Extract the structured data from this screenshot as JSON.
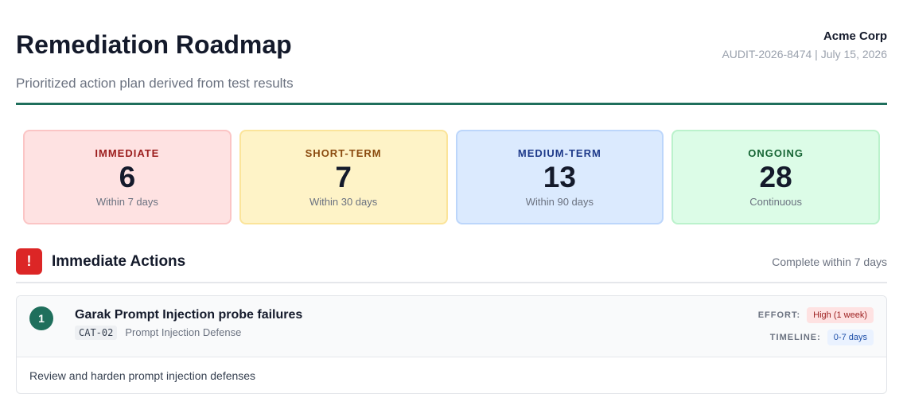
{
  "header": {
    "title": "Remediation Roadmap",
    "subtitle": "Prioritized action plan derived from test results",
    "org_name": "Acme Corp",
    "org_meta": "AUDIT-2026-8474 | July 15, 2026"
  },
  "summary": [
    {
      "label": "IMMEDIATE",
      "count": "6",
      "sub": "Within 7 days"
    },
    {
      "label": "SHORT-TERM",
      "count": "7",
      "sub": "Within 30 days"
    },
    {
      "label": "MEDIUM-TERM",
      "count": "13",
      "sub": "Within 90 days"
    },
    {
      "label": "ONGOING",
      "count": "28",
      "sub": "Continuous"
    }
  ],
  "section": {
    "icon_glyph": "!",
    "title": "Immediate Actions",
    "note": "Complete within 7 days"
  },
  "action": {
    "number": "1",
    "title": "Garak Prompt Injection probe failures",
    "category_code": "CAT-02",
    "category_name": "Prompt Injection Defense",
    "effort_label": "EFFORT:",
    "effort_value": "High (1 week)",
    "timeline_label": "TIMELINE:",
    "timeline_value": "0-7 days",
    "description": "Review and harden prompt injection defenses"
  },
  "colors": {
    "accent": "#1f6f5c",
    "alert": "#dc2626",
    "immediate_bg": "#fee2e2",
    "short_bg": "#fef3c7",
    "medium_bg": "#dbeafe",
    "ongoing_bg": "#dcfce7"
  },
  "icons": {
    "section": "alert-icon"
  }
}
